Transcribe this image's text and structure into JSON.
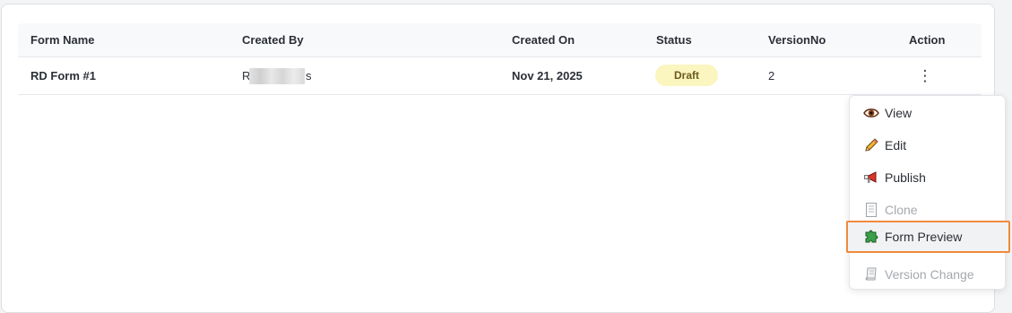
{
  "table": {
    "headers": {
      "form_name": "Form Name",
      "created_by": "Created By",
      "created_on": "Created On",
      "status": "Status",
      "version_no": "VersionNo",
      "action": "Action"
    },
    "rows": [
      {
        "form_name": "RD Form #1",
        "created_by_first": "R",
        "created_by_last": "s",
        "created_on": "Nov 21, 2025",
        "status": "Draft",
        "version_no": "2",
        "action_icon": "⋮"
      }
    ]
  },
  "menu": {
    "items": [
      {
        "label": "View",
        "icon": "eye-icon",
        "enabled": true
      },
      {
        "label": "Edit",
        "icon": "pencil-icon",
        "enabled": true
      },
      {
        "label": "Publish",
        "icon": "megaphone-icon",
        "enabled": true
      },
      {
        "label": "Clone",
        "icon": "document-icon",
        "enabled": false
      },
      {
        "label": "Form Preview",
        "icon": "puzzle-icon",
        "enabled": true,
        "highlighted": true
      },
      {
        "label": "Version Change",
        "icon": "scroll-icon",
        "enabled": false
      }
    ]
  },
  "colors": {
    "status_draft_bg": "#fbf5c0",
    "highlight_border": "#f08a3c"
  }
}
